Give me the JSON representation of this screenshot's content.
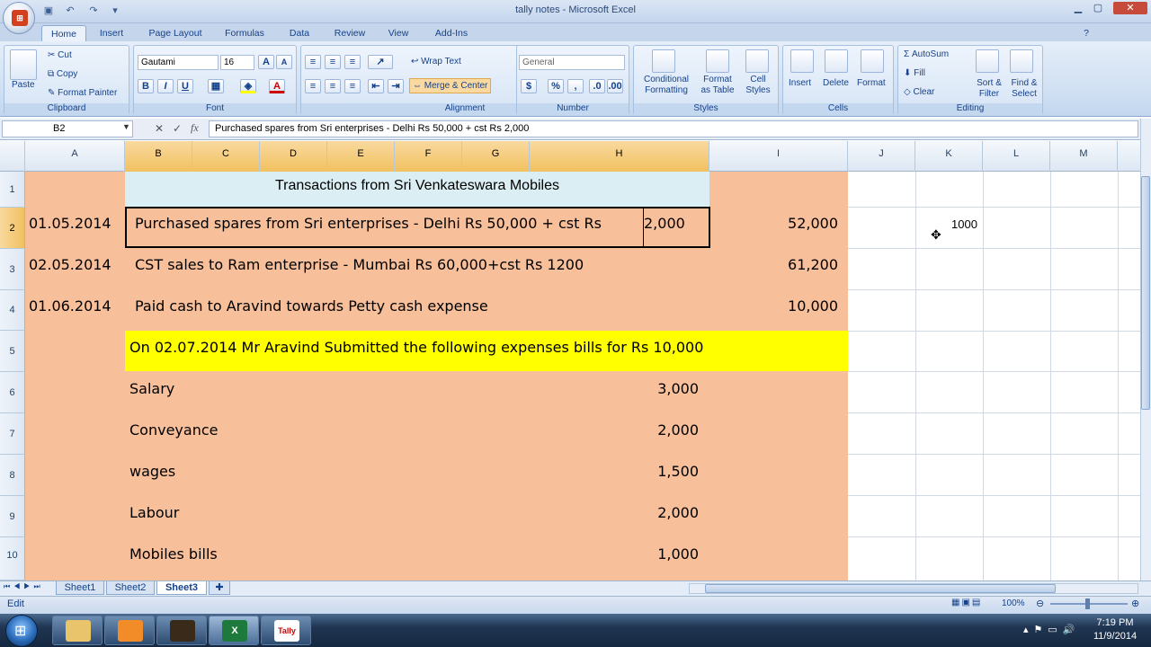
{
  "window": {
    "title": "tally notes - Microsoft Excel"
  },
  "ribbon_tabs": [
    "Home",
    "Insert",
    "Page Layout",
    "Formulas",
    "Data",
    "Review",
    "View",
    "Add-Ins"
  ],
  "clipboard": {
    "paste": "Paste",
    "cut": "Cut",
    "copy": "Copy",
    "format_painter": "Format Painter",
    "label": "Clipboard"
  },
  "font": {
    "name": "Gautami",
    "size": "16",
    "label": "Font",
    "bold": "B",
    "italic": "I",
    "underline": "U"
  },
  "alignment": {
    "wrap": "Wrap Text",
    "merge": "Merge & Center",
    "label": "Alignment"
  },
  "number": {
    "format": "General",
    "currency": "$",
    "percent": "%",
    "comma": ",",
    "label": "Number"
  },
  "styles": {
    "conditional": "Conditional",
    "conditional2": "Formatting",
    "format_table": "Format",
    "format_table2": "as Table",
    "cell_styles": "Cell",
    "cell_styles2": "Styles",
    "label": "Styles"
  },
  "cells": {
    "insert": "Insert",
    "delete": "Delete",
    "format": "Format",
    "label": "Cells"
  },
  "editing": {
    "autosum": "AutoSum",
    "fill": "Fill",
    "clear": "Clear",
    "sort": "Sort &",
    "sort2": "Filter",
    "find": "Find &",
    "find2": "Select",
    "label": "Editing"
  },
  "formula_bar": {
    "name_box": "B2",
    "formula": "Purchased spares from Sri enterprises - Delhi Rs 50,000 + cst Rs 2,000"
  },
  "columns": [
    "A",
    "B",
    "C",
    "D",
    "E",
    "F",
    "G",
    "H",
    "I",
    "J",
    "K",
    "L",
    "M"
  ],
  "rows": [
    "1",
    "2",
    "3",
    "4",
    "5",
    "6",
    "7",
    "8",
    "9",
    "10"
  ],
  "cells_data": {
    "r1_title": "Transactions from Sri Venkateswara Mobiles",
    "r2_date": "01.05.2014",
    "r2_text": "Purchased spares from Sri enterprises - Delhi Rs 50,000 + cst Rs",
    "r2_overflow": "2,000",
    "r2_amount": "52,000",
    "r2_k": "1000",
    "r3_date": "02.05.2014",
    "r3_text": "CST sales to   Ram enterprise - Mumbai  Rs 60,000+cst Rs 1200",
    "r3_amount": "61,200",
    "r4_date": "01.06.2014",
    "r4_text": "Paid cash to Aravind towards  Petty cash expense",
    "r4_amount": "10,000",
    "r5_text": "On 02.07.2014 Mr Aravind Submitted the following expenses bills  for Rs 10,000",
    "expenses": [
      {
        "name": "Salary",
        "amount": "3,000"
      },
      {
        "name": "Conveyance",
        "amount": "2,000"
      },
      {
        "name": "wages",
        "amount": "1,500"
      },
      {
        "name": "Labour",
        "amount": "2,000"
      },
      {
        "name": "Mobiles bills",
        "amount": "1,000"
      }
    ]
  },
  "sheets": [
    "Sheet1",
    "Sheet2",
    "Sheet3"
  ],
  "status": {
    "mode": "Edit",
    "zoom": "100%"
  },
  "clock": {
    "time": "7:19 PM",
    "date": "11/9/2014"
  },
  "colors": {
    "salmon": "#f8bf9b",
    "yellow": "#ffff00",
    "title_fill": "#daeef3"
  }
}
